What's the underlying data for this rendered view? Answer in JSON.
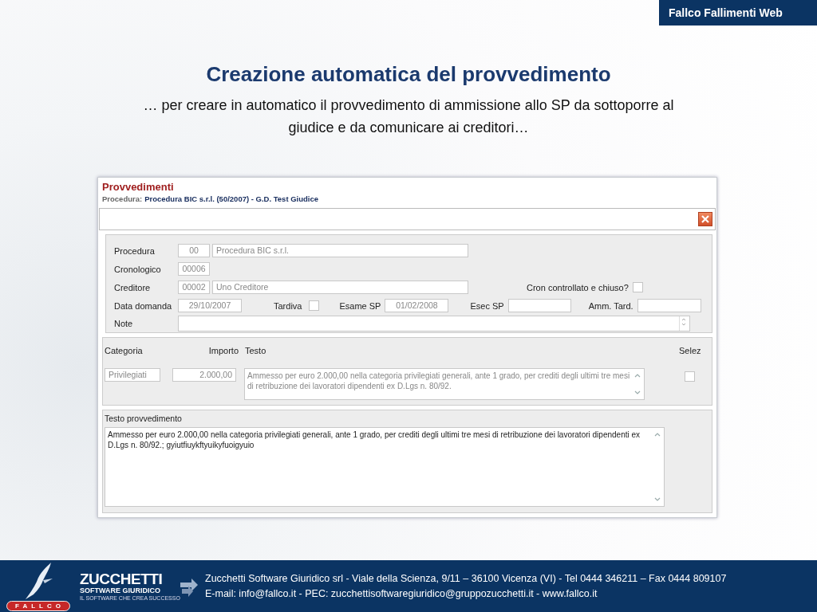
{
  "header_badge": "Fallco Fallimenti Web",
  "slide_title": "Creazione automatica del provvedimento",
  "slide_subtitle": "… per creare in automatico il provvedimento di ammissione allo SP da sottoporre al giudice e da comunicare ai creditori…",
  "app": {
    "title": "Provvedimenti",
    "procedura_label": "Procedura:",
    "procedura_value": "Procedura BIC s.r.l. (50/2007) - G.D. Test Giudice",
    "form": {
      "procedura": {
        "label": "Procedura",
        "code": "00",
        "name": "Procedura BIC s.r.l.",
        "disabled": true
      },
      "cronologico": {
        "label": "Cronologico",
        "code": "00006",
        "disabled": true
      },
      "creditore": {
        "label": "Creditore",
        "code": "00002",
        "name": "Uno Creditore",
        "disabled": true
      },
      "cron_chiuso": {
        "label": "Cron controllato e chiuso?",
        "checked": false
      },
      "data_domanda": {
        "label": "Data domanda",
        "value": "29/10/2007",
        "disabled": true
      },
      "tardiva": {
        "label": "Tardiva",
        "checked": false
      },
      "esame_sp": {
        "label": "Esame SP",
        "value": "01/02/2008",
        "disabled": true
      },
      "esec_sp": {
        "label": "Esec SP"
      },
      "amm_tard": {
        "label": "Amm. Tard."
      },
      "note": {
        "label": "Note"
      }
    },
    "categories": {
      "columns": [
        "Categoria",
        "Importo",
        "Testo",
        "Selez"
      ],
      "rows": [
        {
          "categoria": "Privilegiati",
          "importo": "2.000,00",
          "testo": "Ammesso per euro 2.000,00 nella categoria privilegiati generali, ante 1 grado, per  crediti  degli ultimi tre mesi di retribuzione dei lavoratori dipendenti ex D.Lgs n. 80/92.",
          "disabled": true,
          "selected": false
        }
      ]
    },
    "testo_provvedimento": {
      "label": "Testo provvedimento",
      "value": "Ammesso per euro 2.000,00 nella categoria privilegiati generali, ante 1 grado, per  crediti  degli ultimi tre mesi di retribuzione dei lavoratori dipendenti ex D.Lgs n. 80/92.; gyiutfiuykftyuikyfuoigyuio"
    }
  },
  "footer": {
    "fallco_logo": "FALLCO",
    "zucchetti_logo": "ZUCCHETTI",
    "zucchetti_sub": "SOFTWARE GIURIDICO",
    "zucchetti_tagline": "IL SOFTWARE  CHE CREA SUCCESSO",
    "line_1": "Zucchetti Software Giuridico srl - Viale della Scienza, 9/11 – 36100 Vicenza (VI) - Tel 0444 346211 – Fax 0444 809107",
    "line_2": "E-mail: info@fallco.it - PEC: zucchettisoftwaregiuridico@gruppozucchetti.it - www.fallco.it"
  }
}
